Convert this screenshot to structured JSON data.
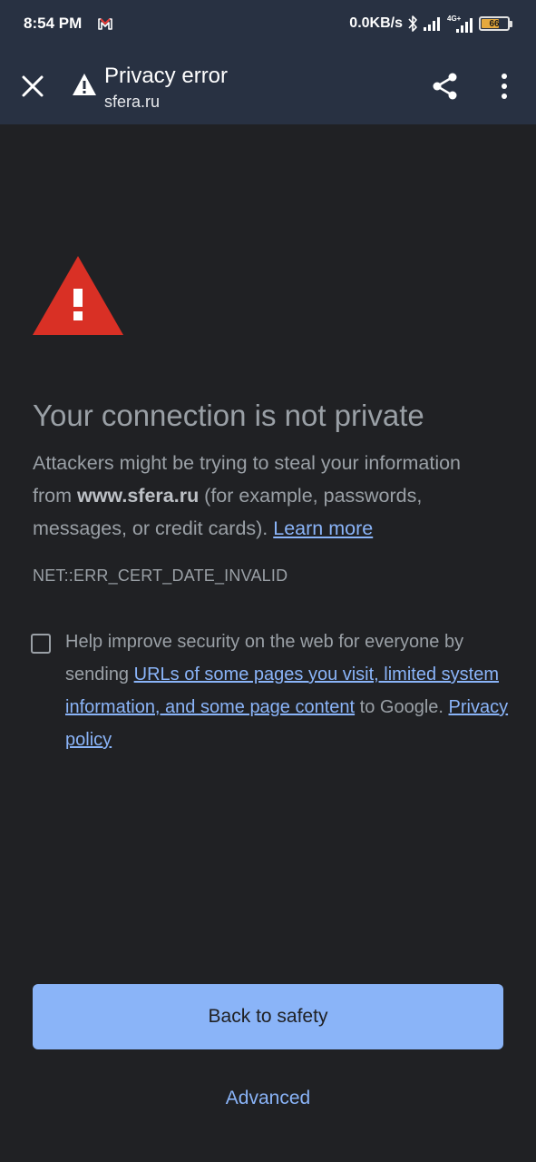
{
  "status_bar": {
    "time": "8:54 PM",
    "net_speed": "0.0KB/s",
    "network_type": "4G+",
    "battery_level": "66",
    "icons": [
      "gmail-icon",
      "bluetooth-icon",
      "signal-icon",
      "signal-4g-icon",
      "battery-icon"
    ]
  },
  "toolbar": {
    "title": "Privacy error",
    "subtitle": "sfera.ru",
    "icons": [
      "close-icon",
      "warning-icon",
      "share-icon",
      "more-vert-icon"
    ]
  },
  "interstitial": {
    "heading": "Your connection is not private",
    "body_prefix": "Attackers might be trying to steal your information from ",
    "domain": "www.sfera.ru",
    "body_suffix": " (for example, passwords, messages, or credit cards). ",
    "learn_more": "Learn more",
    "error_code": "NET::ERR_CERT_DATE_INVALID",
    "optin_prefix": "Help improve security on the web for everyone by sending ",
    "optin_link": "URLs of some pages you visit, limited system information, and some page content",
    "optin_middle": " to Google. ",
    "privacy_policy": "Privacy policy",
    "optin_checked": false
  },
  "buttons": {
    "primary": "Back to safety",
    "secondary": "Advanced"
  },
  "colors": {
    "background": "#202124",
    "toolbar": "#283142",
    "text": "#9aa0a6",
    "link": "#8ab4f8",
    "primary_button": "#8ab4f8",
    "warning_red": "#d93025",
    "battery": "#e5a93d"
  }
}
